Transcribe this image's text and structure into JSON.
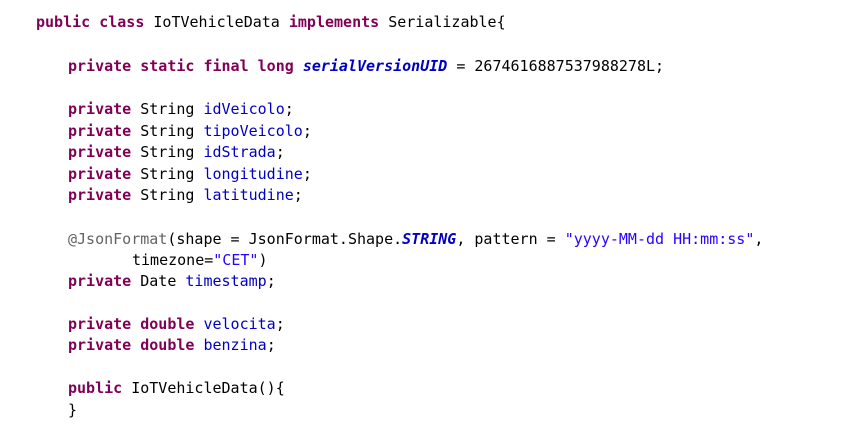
{
  "editor": {
    "language": "java",
    "colors": {
      "keyword": "#7f0055",
      "field": "#0000c0",
      "string": "#2a00ff",
      "annotation": "#646464",
      "text": "#000000",
      "background": "#ffffff"
    },
    "lines": [
      {
        "indent": 0,
        "tokens": [
          {
            "t": "public class",
            "c": "kw"
          },
          {
            "t": " IoTVehicleData ",
            "c": "plain"
          },
          {
            "t": "implements",
            "c": "kw"
          },
          {
            "t": " Serializable{",
            "c": "plain"
          }
        ]
      },
      {
        "indent": 1,
        "tokens": [
          {
            "t": "private static final long",
            "c": "kw"
          },
          {
            "t": " ",
            "c": "plain"
          },
          {
            "t": "serialVersionUID",
            "c": "static-field"
          },
          {
            "t": " = 2674616887537988278L;",
            "c": "plain"
          }
        ]
      },
      {
        "indent": 1,
        "tokens": [
          {
            "t": "private",
            "c": "kw"
          },
          {
            "t": " String ",
            "c": "plain"
          },
          {
            "t": "idVeicolo",
            "c": "field"
          },
          {
            "t": ";",
            "c": "plain"
          }
        ]
      },
      {
        "indent": 1,
        "tokens": [
          {
            "t": "private",
            "c": "kw"
          },
          {
            "t": " String ",
            "c": "plain"
          },
          {
            "t": "tipoVeicolo",
            "c": "field"
          },
          {
            "t": ";",
            "c": "plain"
          }
        ]
      },
      {
        "indent": 1,
        "tokens": [
          {
            "t": "private",
            "c": "kw"
          },
          {
            "t": " String ",
            "c": "plain"
          },
          {
            "t": "idStrada",
            "c": "field"
          },
          {
            "t": ";",
            "c": "plain"
          }
        ]
      },
      {
        "indent": 1,
        "tokens": [
          {
            "t": "private",
            "c": "kw"
          },
          {
            "t": " String ",
            "c": "plain"
          },
          {
            "t": "longitudine",
            "c": "field"
          },
          {
            "t": ";",
            "c": "plain"
          }
        ]
      },
      {
        "indent": 1,
        "tokens": [
          {
            "t": "private",
            "c": "kw"
          },
          {
            "t": " String ",
            "c": "plain"
          },
          {
            "t": "latitudine",
            "c": "field"
          },
          {
            "t": ";",
            "c": "plain"
          }
        ]
      },
      {
        "indent": 1,
        "tokens": [
          {
            "t": "@JsonFormat",
            "c": "ann"
          },
          {
            "t": "(shape = JsonFormat.Shape.",
            "c": "plain"
          },
          {
            "t": "STRING",
            "c": "static-field"
          },
          {
            "t": ", pattern = ",
            "c": "plain"
          },
          {
            "t": "\"yyyy-MM-dd HH:mm:ss\"",
            "c": "str"
          },
          {
            "t": ",",
            "c": "plain"
          }
        ]
      },
      {
        "indent": 3,
        "tokens": [
          {
            "t": "timezone=",
            "c": "plain"
          },
          {
            "t": "\"CET\"",
            "c": "str"
          },
          {
            "t": ")",
            "c": "plain"
          }
        ]
      },
      {
        "indent": 1,
        "tokens": [
          {
            "t": "private",
            "c": "kw"
          },
          {
            "t": " Date ",
            "c": "plain"
          },
          {
            "t": "timestamp",
            "c": "field"
          },
          {
            "t": ";",
            "c": "plain"
          }
        ]
      },
      {
        "indent": 1,
        "tokens": [
          {
            "t": "private double",
            "c": "kw"
          },
          {
            "t": " ",
            "c": "plain"
          },
          {
            "t": "velocita",
            "c": "field"
          },
          {
            "t": ";",
            "c": "plain"
          }
        ]
      },
      {
        "indent": 1,
        "tokens": [
          {
            "t": "private double",
            "c": "kw"
          },
          {
            "t": " ",
            "c": "plain"
          },
          {
            "t": "benzina",
            "c": "field"
          },
          {
            "t": ";",
            "c": "plain"
          }
        ]
      },
      {
        "indent": 1,
        "tokens": [
          {
            "t": "public",
            "c": "kw"
          },
          {
            "t": " IoTVehicleData(){",
            "c": "plain"
          }
        ]
      },
      {
        "indent": 1,
        "tokens": [
          {
            "t": "}",
            "c": "plain"
          }
        ]
      }
    ]
  }
}
